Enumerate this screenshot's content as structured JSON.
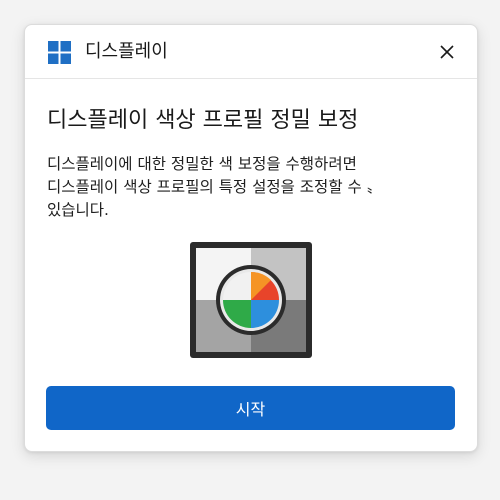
{
  "window": {
    "title": "디스플레이",
    "logo_icon": "windows-logo-icon",
    "close_icon": "close-icon"
  },
  "content": {
    "heading": "디스플레이 색상 프로필 정밀 보정",
    "description_lines": [
      "디스플레이에 대한 정밀한 색 보정을 수행하려면",
      "디스플레이 색상 프로필의 특정 설정을 조정할 수 〟",
      "있습니다."
    ],
    "illustration_icon": "color-calibration-icon"
  },
  "actions": {
    "start_label": "시작"
  },
  "colors": {
    "accent": "#1066c8",
    "logo": "#1f6fc4",
    "wheel_red": "#e8442a",
    "wheel_orange": "#f7a224",
    "wheel_green": "#2faa48",
    "wheel_blue": "#2d8fdd"
  }
}
